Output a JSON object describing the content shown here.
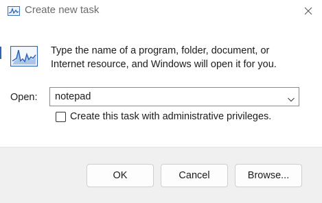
{
  "window": {
    "title": "Create new task",
    "close_icon": "close-icon"
  },
  "dialog": {
    "icon": "task-manager-chart-icon",
    "description_line1": "Type the name of a program, folder, document, or",
    "description_line2": "Internet resource, and Windows will open it for you.",
    "open_label": "Open:",
    "open_value": "notepad",
    "dropdown_icon": "chevron-down-icon",
    "admin_checkbox_label": "Create this task with administrative privileges.",
    "admin_checked": false
  },
  "buttons": {
    "ok": "OK",
    "cancel": "Cancel",
    "browse": "Browse..."
  },
  "colors": {
    "accent": "#2d64b7",
    "footer_bg": "#f0f0f0",
    "title_text": "#6a6a6a"
  }
}
